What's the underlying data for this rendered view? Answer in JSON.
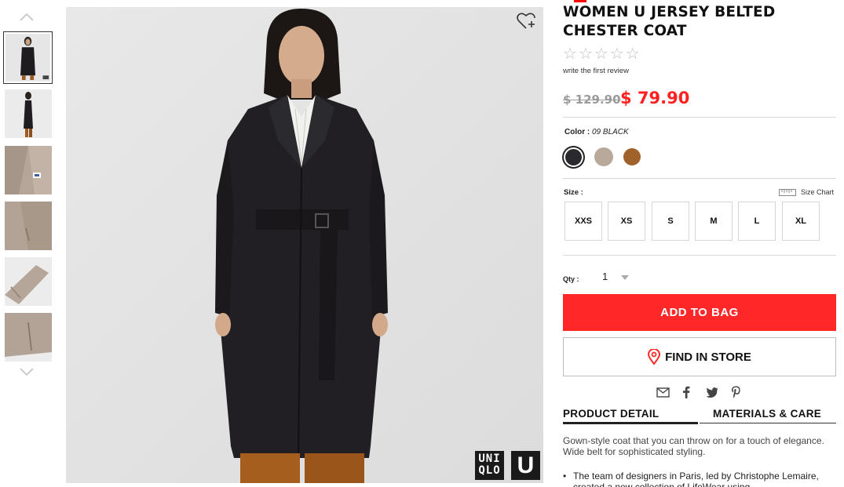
{
  "gallery": {
    "thumbnails": [
      {
        "name": "front view"
      },
      {
        "name": "side view"
      },
      {
        "name": "collar detail"
      },
      {
        "name": "pocket detail"
      },
      {
        "name": "sleeve detail"
      },
      {
        "name": "hem detail"
      }
    ],
    "up_icon": "chevron-up-icon",
    "down_icon": "chevron-down-icon"
  },
  "hero": {
    "wishlist_icon": "heart-plus-icon",
    "logo_lines": [
      "UNI",
      "QLO"
    ],
    "logo_u": "U"
  },
  "product": {
    "title": "WOMEN U JERSEY BELTED CHESTER COAT",
    "rating_stars": [
      "☆",
      "☆",
      "☆",
      "☆",
      "☆"
    ],
    "review_link": "write the first review",
    "old_price": "$ 129.90",
    "price": "$ 79.90",
    "price_color": "#ff2020",
    "color_label": "Color :",
    "color_value": "09 BLACK",
    "colors": [
      {
        "name": "black",
        "hex": "#2a2a2e"
      },
      {
        "name": "beige",
        "hex": "#b9a99b"
      },
      {
        "name": "brown",
        "hex": "#a0622a"
      }
    ],
    "size_label": "Size :",
    "size_chart_label": "Size Chart",
    "sizes": [
      "XXS",
      "XS",
      "S",
      "M",
      "L",
      "XL"
    ],
    "qty_label": "Qty :",
    "qty_value": "1",
    "add_to_bag": "ADD TO BAG",
    "find_in_store": "FIND IN STORE",
    "share_icons": [
      "mail-icon",
      "facebook-icon",
      "twitter-icon",
      "pinterest-icon"
    ],
    "tabs": [
      "PRODUCT DETAIL",
      "MATERIALS & CARE"
    ],
    "description": "Gown-style coat that you can throw on for a touch of elegance. Wide belt for sophisticated styling.",
    "bullets": [
      "The team of designers in Paris, led by Christophe Lemaire, created a new collection of LifeWear using"
    ]
  }
}
